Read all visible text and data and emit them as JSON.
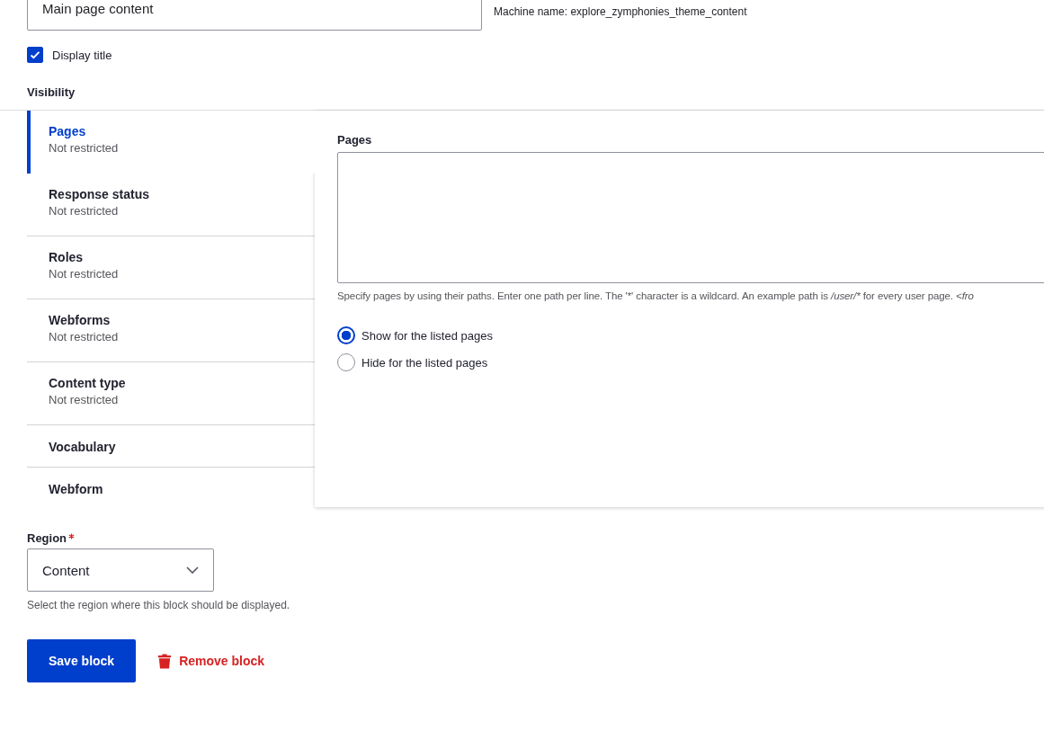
{
  "title_field": {
    "value": "Main page content",
    "machine_name": "Machine name: explore_zymphonies_theme_content"
  },
  "display_title": {
    "label": "Display title",
    "checked": true
  },
  "visibility": {
    "heading": "Visibility",
    "tabs": [
      {
        "label": "Pages",
        "summary": "Not restricted",
        "selected": true
      },
      {
        "label": "Response status",
        "summary": "Not restricted",
        "selected": false
      },
      {
        "label": "Roles",
        "summary": "Not restricted",
        "selected": false
      },
      {
        "label": "Webforms",
        "summary": "Not restricted",
        "selected": false
      },
      {
        "label": "Content type",
        "summary": "Not restricted",
        "selected": false
      },
      {
        "label": "Vocabulary",
        "selected": false
      },
      {
        "label": "Webform",
        "selected": false
      }
    ],
    "pages": {
      "label": "Pages",
      "description": [
        {
          "text": "Specify pages by using their paths. Enter one path per line. The '*' character is a wildcard. An example path is ",
          "kind": "text"
        },
        {
          "text": "/user/*",
          "kind": "example"
        },
        {
          "text": " for every user page. ",
          "kind": "text"
        },
        {
          "text": "<fro",
          "kind": "example"
        }
      ],
      "options": [
        {
          "label": "Show for the listed pages",
          "selected": true
        },
        {
          "label": "Hide for the listed pages",
          "selected": false
        }
      ]
    }
  },
  "region": {
    "label": "Region",
    "required": true,
    "value": "Content",
    "description": "Select the region where this block should be displayed."
  },
  "buttons": [
    {
      "kind": "primary",
      "label": "Save block"
    },
    {
      "kind": "danger",
      "label": "Remove block"
    }
  ]
}
